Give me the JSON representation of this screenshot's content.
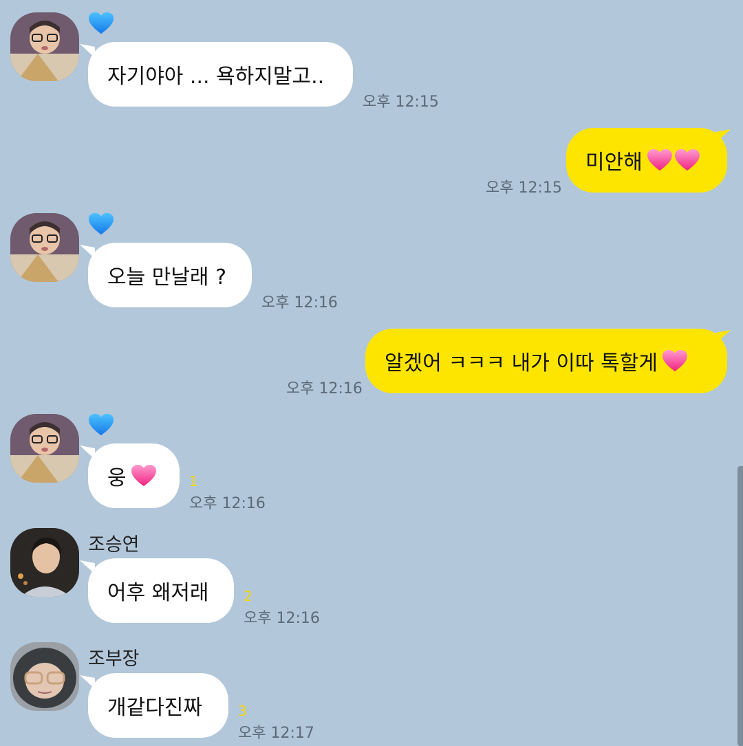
{
  "messages": [
    {
      "sender": "",
      "text": "자기야아 ... 욕하지말고..",
      "time": "오후 12:15",
      "unread": ""
    },
    {
      "sender": "me",
      "text": "미안해",
      "time": "오후 12:15",
      "unread": ""
    },
    {
      "sender": "",
      "text": "오늘 만날래 ?",
      "time": "오후 12:16",
      "unread": ""
    },
    {
      "sender": "me",
      "text": "알겠어 ㅋㅋㅋ 내가 이따 톡할게",
      "time": "오후 12:16",
      "unread": ""
    },
    {
      "sender": "",
      "text": "웅",
      "time": "오후 12:16",
      "unread": "1"
    },
    {
      "sender": "조승연",
      "text": "어후 왜저래",
      "time": "오후 12:16",
      "unread": "2"
    },
    {
      "sender": "조부장",
      "text": "개같다진짜",
      "time": "오후 12:17",
      "unread": "3"
    }
  ],
  "colors": {
    "background": "#b2c7da",
    "incoming_bubble": "#ffffff",
    "outgoing_bubble": "#fee500",
    "unread_count": "#f5d60a"
  },
  "icons": {
    "name_badge": "blue-heart-icon",
    "emoji": "pink-heart-icon"
  }
}
